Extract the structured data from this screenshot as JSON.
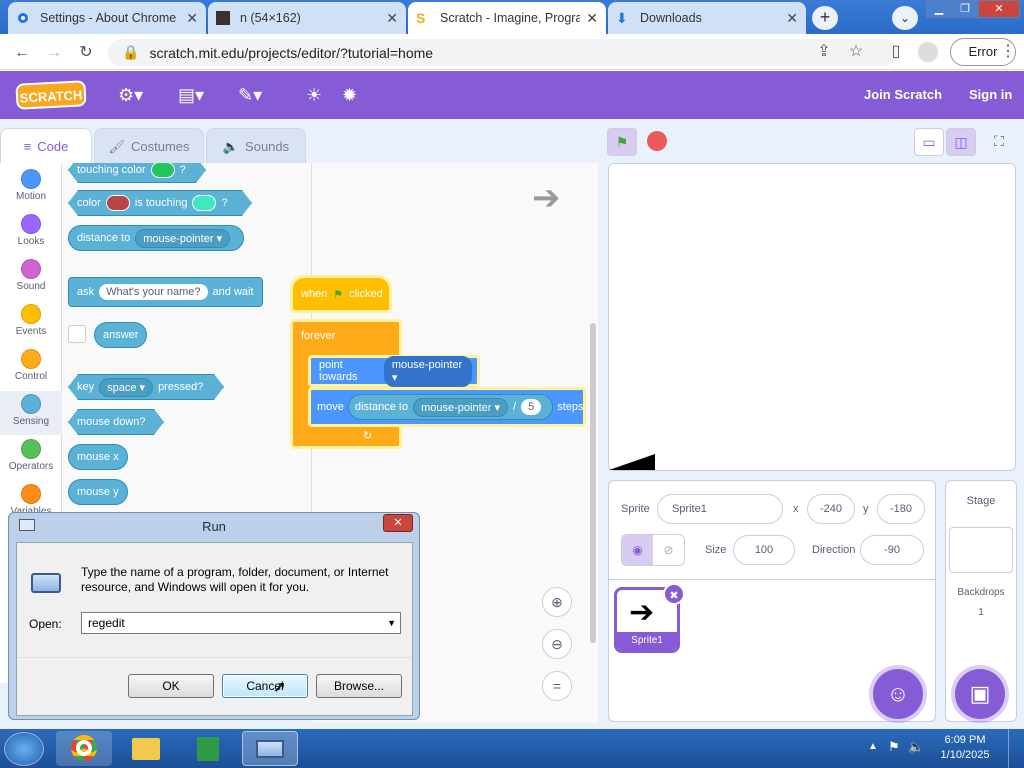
{
  "browser": {
    "tabs": [
      {
        "label": "Settings - About Chrome",
        "icon": "gear-icon"
      },
      {
        "label": "n (54×162)",
        "icon": "image-icon"
      },
      {
        "label": "Scratch - Imagine, Progra",
        "icon": "scratch-icon"
      },
      {
        "label": "Downloads",
        "icon": "download-icon"
      }
    ],
    "url": "scratch.mit.edu/projects/editor/?tutorial=home",
    "error_label": "Error"
  },
  "scratch": {
    "logo": "SCRATCH",
    "join": "Join Scratch",
    "signin": "Sign in",
    "tabs": {
      "code": "Code",
      "costumes": "Costumes",
      "sounds": "Sounds"
    },
    "categories": [
      {
        "label": "Motion",
        "color": "#4c97ff"
      },
      {
        "label": "Looks",
        "color": "#9966ff"
      },
      {
        "label": "Sound",
        "color": "#cf63cf"
      },
      {
        "label": "Events",
        "color": "#ffbf00"
      },
      {
        "label": "Control",
        "color": "#ffab19"
      },
      {
        "label": "Sensing",
        "color": "#5cb1d6"
      },
      {
        "label": "Operators",
        "color": "#59c059"
      },
      {
        "label": "Variables",
        "color": "#ff8c1a"
      }
    ],
    "palette": {
      "touching_color": "touching color",
      "color": "color",
      "is_touching": "is touching",
      "distance_to": "distance to",
      "mouse_pointer": "mouse-pointer",
      "ask": "ask",
      "ask_default": "What's your name?",
      "and_wait": "and wait",
      "answer": "answer",
      "key": "key",
      "space": "space",
      "pressed": "pressed?",
      "mouse_down": "mouse down?",
      "mouse_x": "mouse x",
      "mouse_y": "mouse y",
      "q": "?"
    },
    "script": {
      "when": "when",
      "clicked": "clicked",
      "forever": "forever",
      "point_towards": "point towards",
      "mouse_pointer": "mouse-pointer",
      "move": "move",
      "distance_to": "distance to",
      "divide": "/",
      "divisor": "5",
      "steps": "steps"
    },
    "sprite": {
      "label": "Sprite",
      "name": "Sprite1",
      "x_label": "x",
      "x": "-240",
      "y_label": "y",
      "y": "-180",
      "size_label": "Size",
      "size": "100",
      "direction_label": "Direction",
      "direction": "-90",
      "thumb_name": "Sprite1"
    },
    "stage": {
      "label": "Stage",
      "backdrops_label": "Backdrops",
      "backdrops": "1"
    },
    "zoom": {
      "reset": "="
    }
  },
  "run_dialog": {
    "title": "Run",
    "description": "Type the name of a program, folder, document, or Internet resource, and Windows will open it for you.",
    "open_label": "Open:",
    "value": "regedit",
    "ok": "OK",
    "cancel": "Cancel",
    "browse": "Browse..."
  },
  "taskbar": {
    "time": "6:09 PM",
    "date": "1/10/2025"
  }
}
